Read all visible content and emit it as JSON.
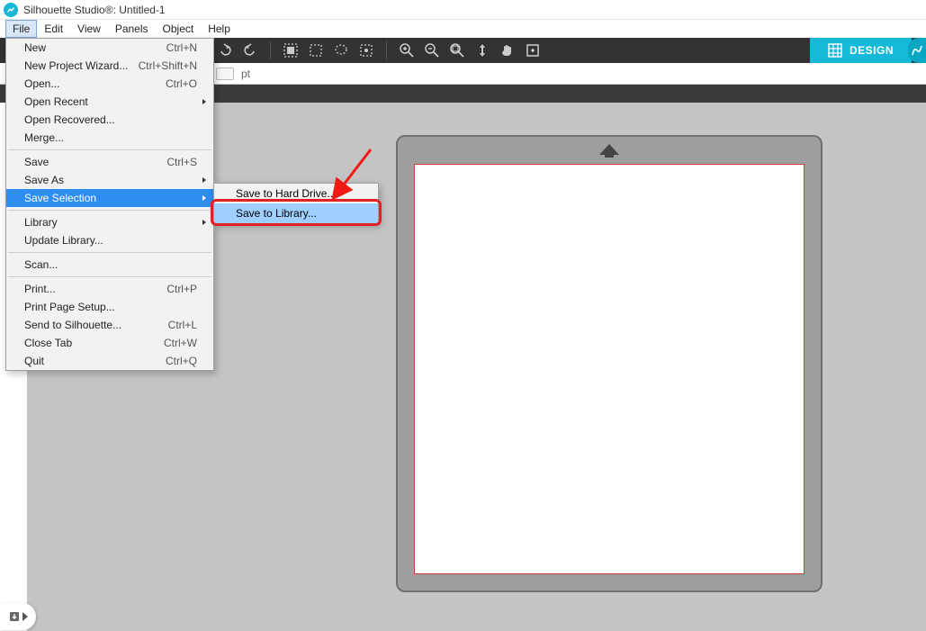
{
  "title": "Silhouette Studio®: Untitled-1",
  "menubar": [
    "File",
    "Edit",
    "View",
    "Panels",
    "Object",
    "Help"
  ],
  "file_menu": {
    "groups": [
      [
        {
          "label": "New",
          "shortcut": "Ctrl+N"
        },
        {
          "label": "New Project Wizard...",
          "shortcut": "Ctrl+Shift+N"
        },
        {
          "label": "Open...",
          "shortcut": "Ctrl+O"
        },
        {
          "label": "Open Recent",
          "submenu": true
        },
        {
          "label": "Open Recovered..."
        },
        {
          "label": "Merge..."
        }
      ],
      [
        {
          "label": "Save",
          "shortcut": "Ctrl+S"
        },
        {
          "label": "Save As",
          "submenu": true
        },
        {
          "label": "Save Selection",
          "submenu": true,
          "selected": true
        }
      ],
      [
        {
          "label": "Library",
          "submenu": true
        },
        {
          "label": "Update Library..."
        }
      ],
      [
        {
          "label": "Scan..."
        }
      ],
      [
        {
          "label": "Print...",
          "shortcut": "Ctrl+P"
        },
        {
          "label": "Print Page Setup..."
        },
        {
          "label": "Send to Silhouette...",
          "shortcut": "Ctrl+L"
        },
        {
          "label": "Close Tab",
          "shortcut": "Ctrl+W"
        },
        {
          "label": "Quit",
          "shortcut": "Ctrl+Q"
        }
      ]
    ]
  },
  "save_selection_submenu": [
    {
      "label": "Save to Hard Drive..."
    },
    {
      "label": "Save to Library...",
      "highlight": true
    }
  ],
  "optionsbar": {
    "unit": "pt"
  },
  "design_tab": "DESIGN",
  "toolbar_icons": [
    "undo",
    "redo",
    "select-all",
    "select-rect",
    "select-lasso",
    "select-magic",
    "zoom-in",
    "zoom-out",
    "zoom-fit",
    "zoom-selection",
    "pan",
    "fit-page"
  ]
}
